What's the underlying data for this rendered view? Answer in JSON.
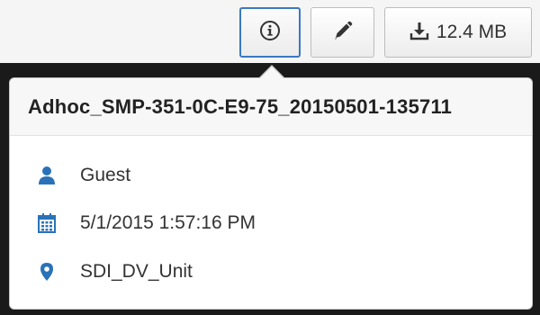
{
  "toolbar": {
    "info_icon": "info-icon",
    "edit_icon": "pencil-icon",
    "download_icon": "download-icon",
    "download_size": "12.4 MB"
  },
  "popover": {
    "title": "Adhoc_SMP-351-0C-E9-75_20150501-135711",
    "items": [
      {
        "icon": "user-icon",
        "text": "Guest"
      },
      {
        "icon": "calendar-icon",
        "text": "5/1/2015 1:57:16 PM"
      },
      {
        "icon": "location-pin-icon",
        "text": "SDI_DV_Unit"
      }
    ]
  },
  "colors": {
    "accent": "#3a78c2",
    "icon_blue": "#2a72b8",
    "dark_background": "#1a1a1a"
  }
}
